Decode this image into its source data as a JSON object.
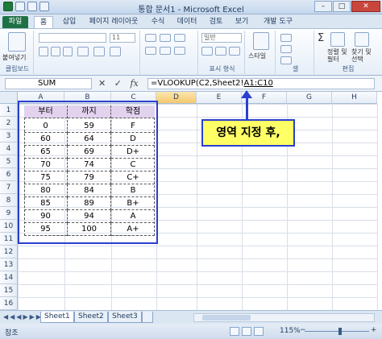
{
  "window": {
    "title": "통합 문서1 - Microsoft Excel",
    "min": "–",
    "max": "□",
    "close": "✕"
  },
  "tabs": [
    "파일",
    "홈",
    "삽입",
    "페이지 레이아웃",
    "수식",
    "데이터",
    "검토",
    "보기",
    "개발 도구"
  ],
  "ribbon": {
    "paste_label": "붙여넣기",
    "clipboard_label": "클립보드",
    "font_size": "11",
    "number_format": "일반",
    "style_label": "스타일",
    "cells_label": "셀",
    "sort_label": "정렬 및\n필터",
    "find_label": "찾기 및\n선택",
    "edit_label": "편집",
    "number_label": "표시 형식"
  },
  "formula_bar": {
    "name_box": "SUM",
    "cancel": "✕",
    "enter": "✓",
    "fx": "fx",
    "formula_prefix": "=VLOOKUP(C2,Sheet2!",
    "formula_ref": "A1:C10"
  },
  "columns": [
    "A",
    "B",
    "C",
    "D",
    "E",
    "F",
    "G",
    "H"
  ],
  "rows": [
    "1",
    "2",
    "3",
    "4",
    "5",
    "6",
    "7",
    "8",
    "9",
    "10",
    "11",
    "12",
    "13",
    "14",
    "15",
    "16"
  ],
  "table": {
    "headers": [
      "부터",
      "까지",
      "학점"
    ],
    "rows": [
      [
        "0",
        "59",
        "F"
      ],
      [
        "60",
        "64",
        "D"
      ],
      [
        "65",
        "69",
        "D+"
      ],
      [
        "70",
        "74",
        "C"
      ],
      [
        "75",
        "79",
        "C+"
      ],
      [
        "80",
        "84",
        "B"
      ],
      [
        "85",
        "89",
        "B+"
      ],
      [
        "90",
        "94",
        "A"
      ],
      [
        "95",
        "100",
        "A+"
      ]
    ]
  },
  "callout": "영역 지정 후,",
  "sheet_tabs": [
    "Sheet1",
    "Sheet2",
    "Sheet3"
  ],
  "status": {
    "mode": "참조",
    "zoom": "115%",
    "zoom_minus": "−",
    "zoom_plus": "+"
  },
  "colors": {
    "accent": "#2a3fcf",
    "callout_bg": "#ffff66",
    "header_bg": "#e2d2ee"
  }
}
